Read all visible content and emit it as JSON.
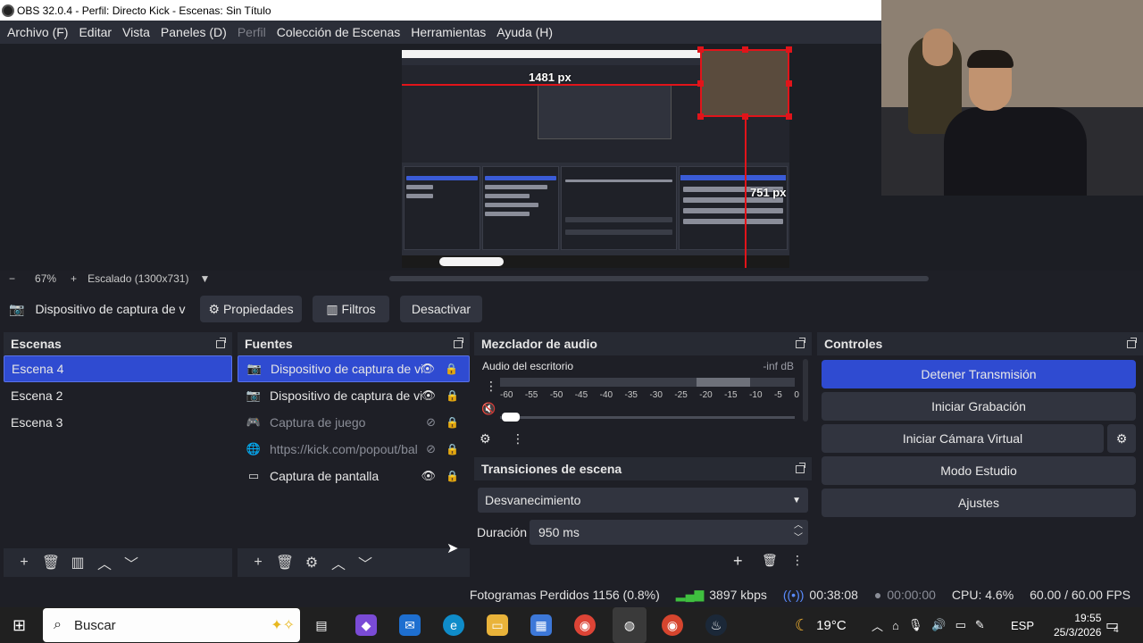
{
  "window": {
    "title": "OBS 32.0.4 - Perfil: Directo Kick - Escenas: Sin Título"
  },
  "menu": [
    "Archivo (F)",
    "Editar",
    "Vista",
    "Paneles (D)",
    "Perfil",
    "Colección de Escenas",
    "Herramientas",
    "Ayuda (H)"
  ],
  "preview": {
    "guide_horizontal": "1481 px",
    "guide_vertical": "751 px"
  },
  "zoom": {
    "minus": "−",
    "value": "67%",
    "plus": "+",
    "scale": "Escalado (1300x731)"
  },
  "source_toolbar": {
    "source_name": "Dispositivo de captura de v",
    "properties": "Propiedades",
    "filters": "Filtros",
    "deactivate": "Desactivar"
  },
  "scenes": {
    "title": "Escenas",
    "items": [
      "Escena 4",
      "Escena 2",
      "Escena 3"
    ],
    "selected": "Escena 4"
  },
  "sources": {
    "title": "Fuentes",
    "items": [
      {
        "label": "Dispositivo de captura de vi",
        "icon": "camera-icon",
        "visible": true
      },
      {
        "label": "Dispositivo de captura de vi",
        "icon": "camera-icon",
        "visible": true
      },
      {
        "label": "Captura de juego",
        "icon": "gamepad-icon",
        "visible": false
      },
      {
        "label": "https://kick.com/popout/bal",
        "icon": "globe-icon",
        "visible": false
      },
      {
        "label": "Captura de pantalla",
        "icon": "monitor-icon",
        "visible": true
      }
    ]
  },
  "audio": {
    "title": "Mezclador de audio",
    "channel": "Audio del escritorio",
    "level": "-inf dB",
    "ticks": [
      "-60",
      "-55",
      "-50",
      "-45",
      "-40",
      "-35",
      "-30",
      "-25",
      "-20",
      "-15",
      "-10",
      "-5",
      "0"
    ]
  },
  "transitions": {
    "title": "Transiciones de escena",
    "selected": "Desvanecimiento",
    "duration_label": "Duración",
    "duration_value": "950 ms"
  },
  "controls": {
    "title": "Controles",
    "stop_stream": "Detener Transmisión",
    "start_recording": "Iniciar Grabación",
    "virtual_camera": "Iniciar Cámara Virtual",
    "studio_mode": "Modo Estudio",
    "settings": "Ajustes"
  },
  "status": {
    "dropped_frames": "Fotogramas Perdidos 1156 (0.8%)",
    "bitrate": "3897 kbps",
    "stream_time": "00:38:08",
    "rec_time": "00:00:00",
    "cpu": "CPU: 4.6%",
    "fps": "60.00 / 60.00 FPS"
  },
  "taskbar": {
    "search_placeholder": "Buscar",
    "weather": "19°C",
    "language": "ESP",
    "time": "19:55",
    "date": "25/3/2026",
    "notifications": "4"
  },
  "colors": {
    "accent": "#2f4bd1",
    "guide": "#e1141a"
  }
}
